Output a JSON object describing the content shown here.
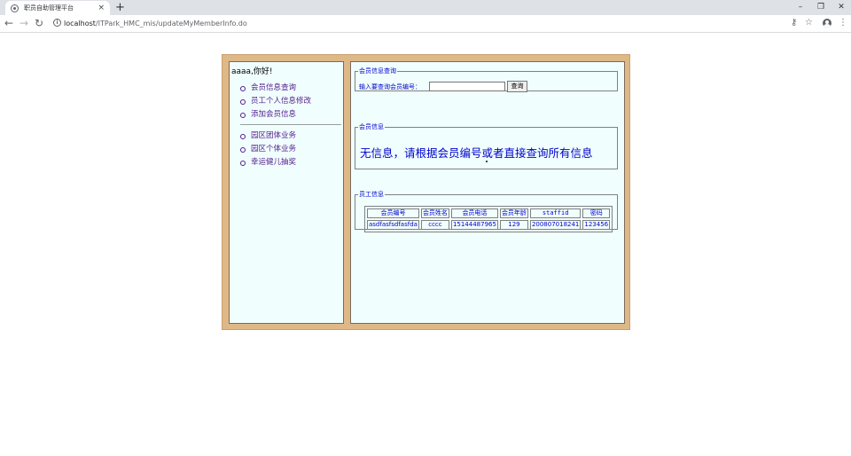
{
  "browser": {
    "tab_title": "职员自助管理平台",
    "tab_close": "×",
    "new_tab": "+",
    "url_host": "localhost",
    "url_path": "/ITPark_HMC_mis/updateMyMemberInfo.do",
    "window_controls": {
      "minimize": "–",
      "restore": "❐",
      "close": "✕"
    },
    "nav": {
      "back": "←",
      "forward": "→",
      "reload": "↻"
    },
    "icons": {
      "key": "⚷",
      "star": "☆",
      "menu": "⋮"
    }
  },
  "sidebar": {
    "greeting": "aaaa,你好!",
    "group1": [
      {
        "label": "会员信息查询"
      },
      {
        "label": "员工个人信息修改"
      },
      {
        "label": "添加会员信息"
      }
    ],
    "group2": [
      {
        "label": "园区团体业务"
      },
      {
        "label": "园区个体业务"
      },
      {
        "label": "幸运健儿抽奖"
      }
    ]
  },
  "query": {
    "legend": "会员信息查询",
    "label": "输入要查询会员编号：",
    "input_value": "",
    "button_label": "查询"
  },
  "member_info": {
    "legend": "会员信息",
    "message": "无信息，请根据会员编号或者直接查询所有信息"
  },
  "staff_info": {
    "legend": "员工信息",
    "headers": [
      "会员编号",
      "会员姓名",
      "会员电话",
      "会员年龄",
      "staffid",
      "密码"
    ],
    "rows": [
      [
        "asdfasfsdfasfda",
        "cccc",
        "15144487965",
        "129",
        "200807018241",
        "123456"
      ]
    ]
  }
}
